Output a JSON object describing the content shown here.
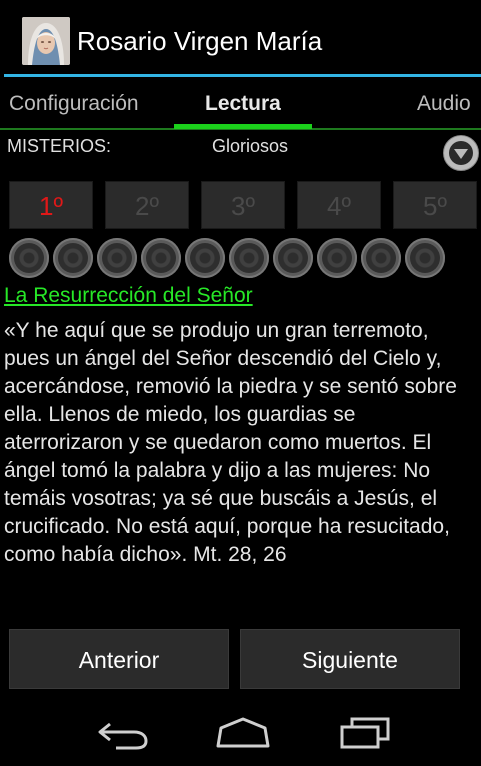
{
  "app": {
    "title": "Rosario Virgen María",
    "icon": "virgin-mary-portrait"
  },
  "tabs": [
    {
      "label": "Configuración",
      "active": false
    },
    {
      "label": "Lectura",
      "active": true
    },
    {
      "label": "Audio",
      "active": false
    }
  ],
  "misterios": {
    "label": "MISTERIOS:",
    "selected": "Gloriosos"
  },
  "mystery_buttons": [
    "1º",
    "2º",
    "3º",
    "4º",
    "5º"
  ],
  "active_mystery": "1º",
  "beads": {
    "count": 10,
    "completed": 0
  },
  "reading": {
    "title": "La Resurrección del Señor",
    "text": "«Y he aquí que se produjo un gran terremoto, pues un ángel del Señor descendió del Cielo y, acercándose, removió la piedra y se sentó sobre ella. Llenos de miedo, los guardias se aterrorizaron y se quedaron como muertos. El ángel tomó la palabra y dijo a las mujeres: No temáis vosotras; ya sé que buscáis a Jesús, el crucificado. No está aquí, porque ha resucitado, como había dicho». Mt. 28, 26"
  },
  "nav": {
    "previous": "Anterior",
    "next": "Siguiente"
  },
  "system_bar": {
    "icons": [
      "back-icon",
      "home-icon",
      "recent-apps-icon"
    ]
  },
  "colors": {
    "accent": "#33b5e5",
    "tab_indicator": "#1bd11b",
    "link": "#27e827",
    "active_mystery": "#e01818"
  }
}
